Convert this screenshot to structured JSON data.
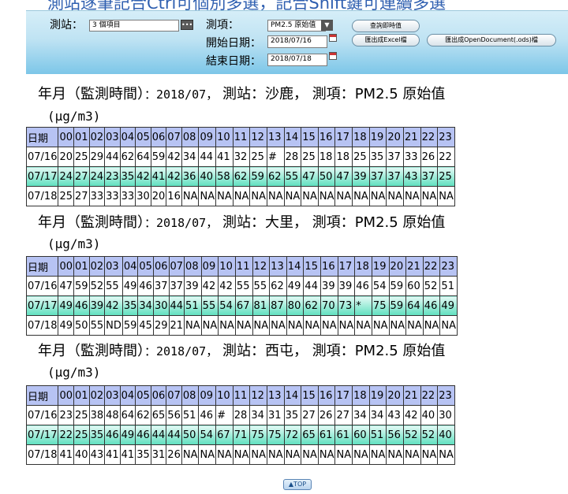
{
  "banner_text": "測站逐筆記合Ctrl可個別多選，記合Shift鍵可連續多選",
  "query_form": {
    "station_label": "測站：",
    "station_value": "3 個項目",
    "item_label": "測項：",
    "item_value": "PM2.5 原始值",
    "start_label": "開始日期：",
    "start_value": "2018/07/16",
    "end_label": "結束日期：",
    "end_value": "2018/07/18",
    "btn_query": "查詢即時值",
    "btn_excel": "匯出成Excel檔",
    "btn_ods": "匯出成OpenDocument(.ods)檔"
  },
  "unit": "(μg/m3)",
  "sections": [
    {
      "title_prefix": "年月（監測時間）",
      "title_month": "：2018/07，",
      "station_prefix": "測站：",
      "station": "沙鹿，",
      "item_prefix": "測項：",
      "item": "PM2.5 原始值",
      "header": [
        "日期",
        "00",
        "01",
        "02",
        "03",
        "04",
        "05",
        "06",
        "07",
        "08",
        "09",
        "10",
        "11",
        "12",
        "13",
        "14",
        "15",
        "16",
        "17",
        "18",
        "19",
        "20",
        "21",
        "22",
        "23"
      ],
      "rows": [
        [
          "07/16",
          "20",
          "25",
          "29",
          "44",
          "62",
          "64",
          "59",
          "42",
          "34",
          "44",
          "41",
          "32",
          "25",
          "#",
          "28",
          "25",
          "18",
          "18",
          "25",
          "35",
          "37",
          "33",
          "26",
          "22"
        ],
        [
          "07/17",
          "24",
          "27",
          "24",
          "23",
          "35",
          "42",
          "41",
          "42",
          "36",
          "40",
          "58",
          "62",
          "59",
          "62",
          "55",
          "47",
          "50",
          "47",
          "39",
          "37",
          "37",
          "43",
          "37",
          "25"
        ],
        [
          "07/18",
          "25",
          "27",
          "33",
          "33",
          "33",
          "30",
          "20",
          "16",
          "NA",
          "NA",
          "NA",
          "NA",
          "NA",
          "NA",
          "NA",
          "NA",
          "NA",
          "NA",
          "NA",
          "NA",
          "NA",
          "NA",
          "NA",
          "NA"
        ]
      ]
    },
    {
      "title_prefix": "年月（監測時間）",
      "title_month": "：2018/07，",
      "station_prefix": "測站：",
      "station": "大里，",
      "item_prefix": "測項：",
      "item": "PM2.5 原始值",
      "header": [
        "日期",
        "00",
        "01",
        "02",
        "03",
        "04",
        "05",
        "06",
        "07",
        "08",
        "09",
        "10",
        "11",
        "12",
        "13",
        "14",
        "15",
        "16",
        "17",
        "18",
        "19",
        "20",
        "21",
        "22",
        "23"
      ],
      "rows": [
        [
          "07/16",
          "47",
          "59",
          "52",
          "55",
          "49",
          "46",
          "37",
          "37",
          "39",
          "42",
          "42",
          "55",
          "55",
          "62",
          "49",
          "44",
          "39",
          "39",
          "46",
          "54",
          "59",
          "60",
          "52",
          "51"
        ],
        [
          "07/17",
          "49",
          "46",
          "39",
          "42",
          "35",
          "34",
          "30",
          "44",
          "51",
          "55",
          "54",
          "67",
          "81",
          "87",
          "80",
          "62",
          "70",
          "73",
          "*",
          "75",
          "59",
          "64",
          "46",
          "49"
        ],
        [
          "07/18",
          "49",
          "50",
          "55",
          "ND",
          "59",
          "45",
          "29",
          "21",
          "NA",
          "NA",
          "NA",
          "NA",
          "NA",
          "NA",
          "NA",
          "NA",
          "NA",
          "NA",
          "NA",
          "NA",
          "NA",
          "NA",
          "NA",
          "NA"
        ]
      ]
    },
    {
      "title_prefix": "年月（監測時間）",
      "title_month": "：2018/07，",
      "station_prefix": "測站：",
      "station": "西屯，",
      "item_prefix": "測項：",
      "item": "PM2.5 原始值",
      "header": [
        "日期",
        "00",
        "01",
        "02",
        "03",
        "04",
        "05",
        "06",
        "07",
        "08",
        "09",
        "10",
        "11",
        "12",
        "13",
        "14",
        "15",
        "16",
        "17",
        "18",
        "19",
        "20",
        "21",
        "22",
        "23"
      ],
      "rows": [
        [
          "07/16",
          "23",
          "25",
          "38",
          "48",
          "64",
          "62",
          "65",
          "56",
          "51",
          "46",
          "#",
          "28",
          "34",
          "31",
          "35",
          "27",
          "26",
          "27",
          "34",
          "34",
          "43",
          "42",
          "40",
          "30"
        ],
        [
          "07/17",
          "22",
          "25",
          "35",
          "46",
          "49",
          "46",
          "44",
          "44",
          "50",
          "54",
          "67",
          "71",
          "75",
          "75",
          "72",
          "65",
          "61",
          "61",
          "60",
          "51",
          "56",
          "52",
          "52",
          "40"
        ],
        [
          "07/18",
          "41",
          "40",
          "43",
          "41",
          "41",
          "35",
          "31",
          "26",
          "NA",
          "NA",
          "NA",
          "NA",
          "NA",
          "NA",
          "NA",
          "NA",
          "NA",
          "NA",
          "NA",
          "NA",
          "NA",
          "NA",
          "NA",
          "NA"
        ]
      ]
    }
  ],
  "top_link": "▲TOP"
}
